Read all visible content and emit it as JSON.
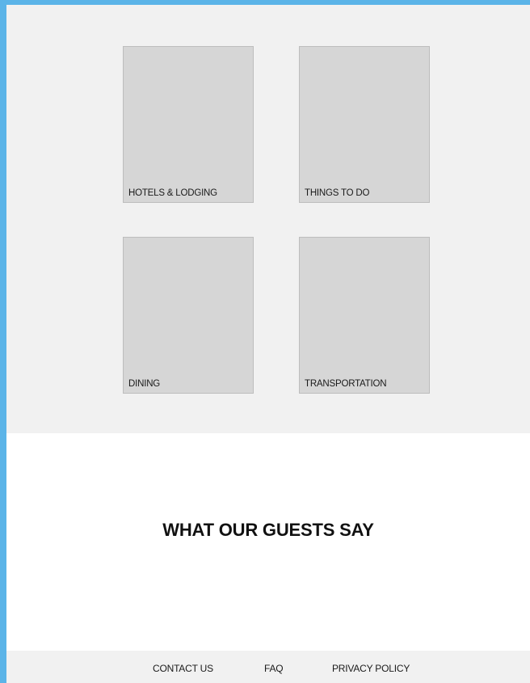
{
  "categories": [
    {
      "label": "HOTELS & LODGING"
    },
    {
      "label": "THINGS TO DO"
    },
    {
      "label": "DINING"
    },
    {
      "label": "TRANSPORTATION"
    }
  ],
  "testimonials": {
    "heading": "WHAT OUR GUESTS SAY"
  },
  "footer": {
    "links": [
      {
        "label": "CONTACT US"
      },
      {
        "label": "FAQ"
      },
      {
        "label": "PRIVACY POLICY"
      }
    ]
  },
  "colors": {
    "frame": "#5bb4e8",
    "section_bg": "#f1f1f1",
    "tile_bg": "#d6d6d6",
    "tile_border": "#bdbdbd"
  }
}
